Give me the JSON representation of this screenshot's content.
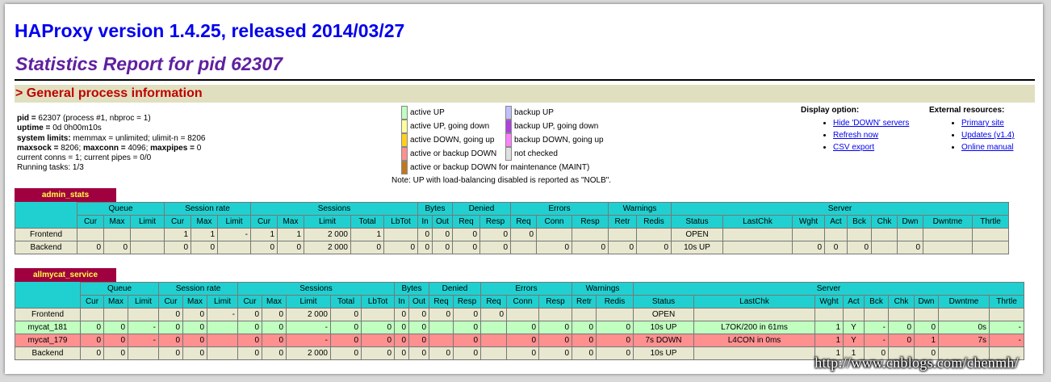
{
  "header": {
    "title": "HAProxy version 1.4.25, released 2014/03/27",
    "subtitle": "Statistics Report for pid 62307"
  },
  "section": {
    "title": "> General process information"
  },
  "info": {
    "l1k": "pid = ",
    "l1v": "62307 (process #1, nbproc = 1)",
    "l2k": "uptime = ",
    "l2v": "0d 0h00m10s",
    "l3k": "system limits:",
    "l3v": " memmax = unlimited; ulimit-n = 8206",
    "l4ak": "maxsock = ",
    "l4av": "8206; ",
    "l4bk": "maxconn = ",
    "l4bv": "4096; ",
    "l4ck": "maxpipes = ",
    "l4cv": "0",
    "l5": "current conns = 1; current pipes = 0/0",
    "l6": "Running tasks: 1/3"
  },
  "legend": {
    "left": [
      {
        "label": "active UP",
        "color": "#c0ffc0"
      },
      {
        "label": "active UP, going down",
        "color": "#ffffa0"
      },
      {
        "label": "active DOWN, going up",
        "color": "#ffd020"
      },
      {
        "label": "active or backup DOWN",
        "color": "#ff9090"
      },
      {
        "label": "active or backup DOWN for maintenance (MAINT)",
        "color": "#c07820"
      }
    ],
    "right": [
      {
        "label": "backup UP",
        "color": "#c0c0ff"
      },
      {
        "label": "backup UP, going down",
        "color": "#b040e0"
      },
      {
        "label": "backup DOWN, going up",
        "color": "#ff80ff"
      },
      {
        "label": "not checked",
        "color": "#e0e0e0"
      }
    ],
    "note": "Note: UP with load-balancing disabled is reported as \"NOLB\"."
  },
  "display": {
    "title": "Display option:",
    "links": [
      "Hide 'DOWN' servers",
      "Refresh now",
      "CSV export"
    ]
  },
  "external": {
    "title": "External resources:",
    "links": [
      "Primary site",
      "Updates (v1.4)",
      "Online manual"
    ]
  },
  "columns": {
    "groups": [
      "Queue",
      "Session rate",
      "Sessions",
      "Bytes",
      "Denied",
      "Errors",
      "Warnings",
      "Server"
    ],
    "sub": [
      "Cur",
      "Max",
      "Limit",
      "Cur",
      "Max",
      "Limit",
      "Cur",
      "Max",
      "Limit",
      "Total",
      "LbTot",
      "In",
      "Out",
      "Req",
      "Resp",
      "Req",
      "Conn",
      "Resp",
      "Retr",
      "Redis",
      "Status",
      "LastChk",
      "Wght",
      "Act",
      "Bck",
      "Chk",
      "Dwn",
      "Dwntme",
      "Thrtle"
    ]
  },
  "proxies": [
    {
      "name": "admin_stats",
      "rows": [
        {
          "kind": "fe",
          "cells": [
            "Frontend",
            "",
            "",
            "",
            "1",
            "1",
            "-",
            "1",
            "1",
            "2 000",
            "1",
            "",
            "0",
            "0",
            "0",
            "0",
            "0",
            "",
            "",
            "",
            "",
            "OPEN",
            "",
            "",
            "",
            "",
            "",
            "",
            "",
            ""
          ]
        },
        {
          "kind": "be",
          "cells": [
            "Backend",
            "0",
            "0",
            "",
            "0",
            "0",
            "",
            "0",
            "0",
            "2 000",
            "0",
            "0",
            "0",
            "0",
            "0",
            "0",
            "",
            "0",
            "0",
            "0",
            "0",
            "10s UP",
            "",
            "0",
            "0",
            "0",
            "",
            "0",
            "",
            ""
          ]
        }
      ]
    },
    {
      "name": "allmycat_service",
      "rows": [
        {
          "kind": "fe",
          "cells": [
            "Frontend",
            "",
            "",
            "",
            "0",
            "0",
            "-",
            "0",
            "0",
            "2 000",
            "0",
            "",
            "0",
            "0",
            "0",
            "0",
            "0",
            "",
            "",
            "",
            "",
            "OPEN",
            "",
            "",
            "",
            "",
            "",
            "",
            "",
            ""
          ]
        },
        {
          "kind": "up",
          "cells": [
            "mycat_181",
            "0",
            "0",
            "-",
            "0",
            "0",
            "",
            "0",
            "0",
            "-",
            "0",
            "0",
            "0",
            "0",
            "",
            "0",
            "",
            "0",
            "0",
            "0",
            "0",
            "10s UP",
            "L7OK/200 in 61ms",
            "1",
            "Y",
            "-",
            "0",
            "0",
            "0s",
            "-"
          ]
        },
        {
          "kind": "down",
          "cells": [
            "mycat_179",
            "0",
            "0",
            "-",
            "0",
            "0",
            "",
            "0",
            "0",
            "-",
            "0",
            "0",
            "0",
            "0",
            "",
            "0",
            "",
            "0",
            "0",
            "0",
            "0",
            "7s DOWN",
            "L4CON in 0ms",
            "1",
            "Y",
            "-",
            "0",
            "1",
            "7s",
            "-"
          ]
        },
        {
          "kind": "be",
          "cells": [
            "Backend",
            "0",
            "0",
            "",
            "0",
            "0",
            "",
            "0",
            "0",
            "2 000",
            "0",
            "0",
            "0",
            "0",
            "0",
            "0",
            "",
            "0",
            "0",
            "0",
            "0",
            "10s UP",
            "",
            "1",
            "1",
            "0",
            "",
            "0",
            "",
            ""
          ]
        }
      ]
    }
  ],
  "watermark": "http://www.cnblogs.com/chenmh/"
}
